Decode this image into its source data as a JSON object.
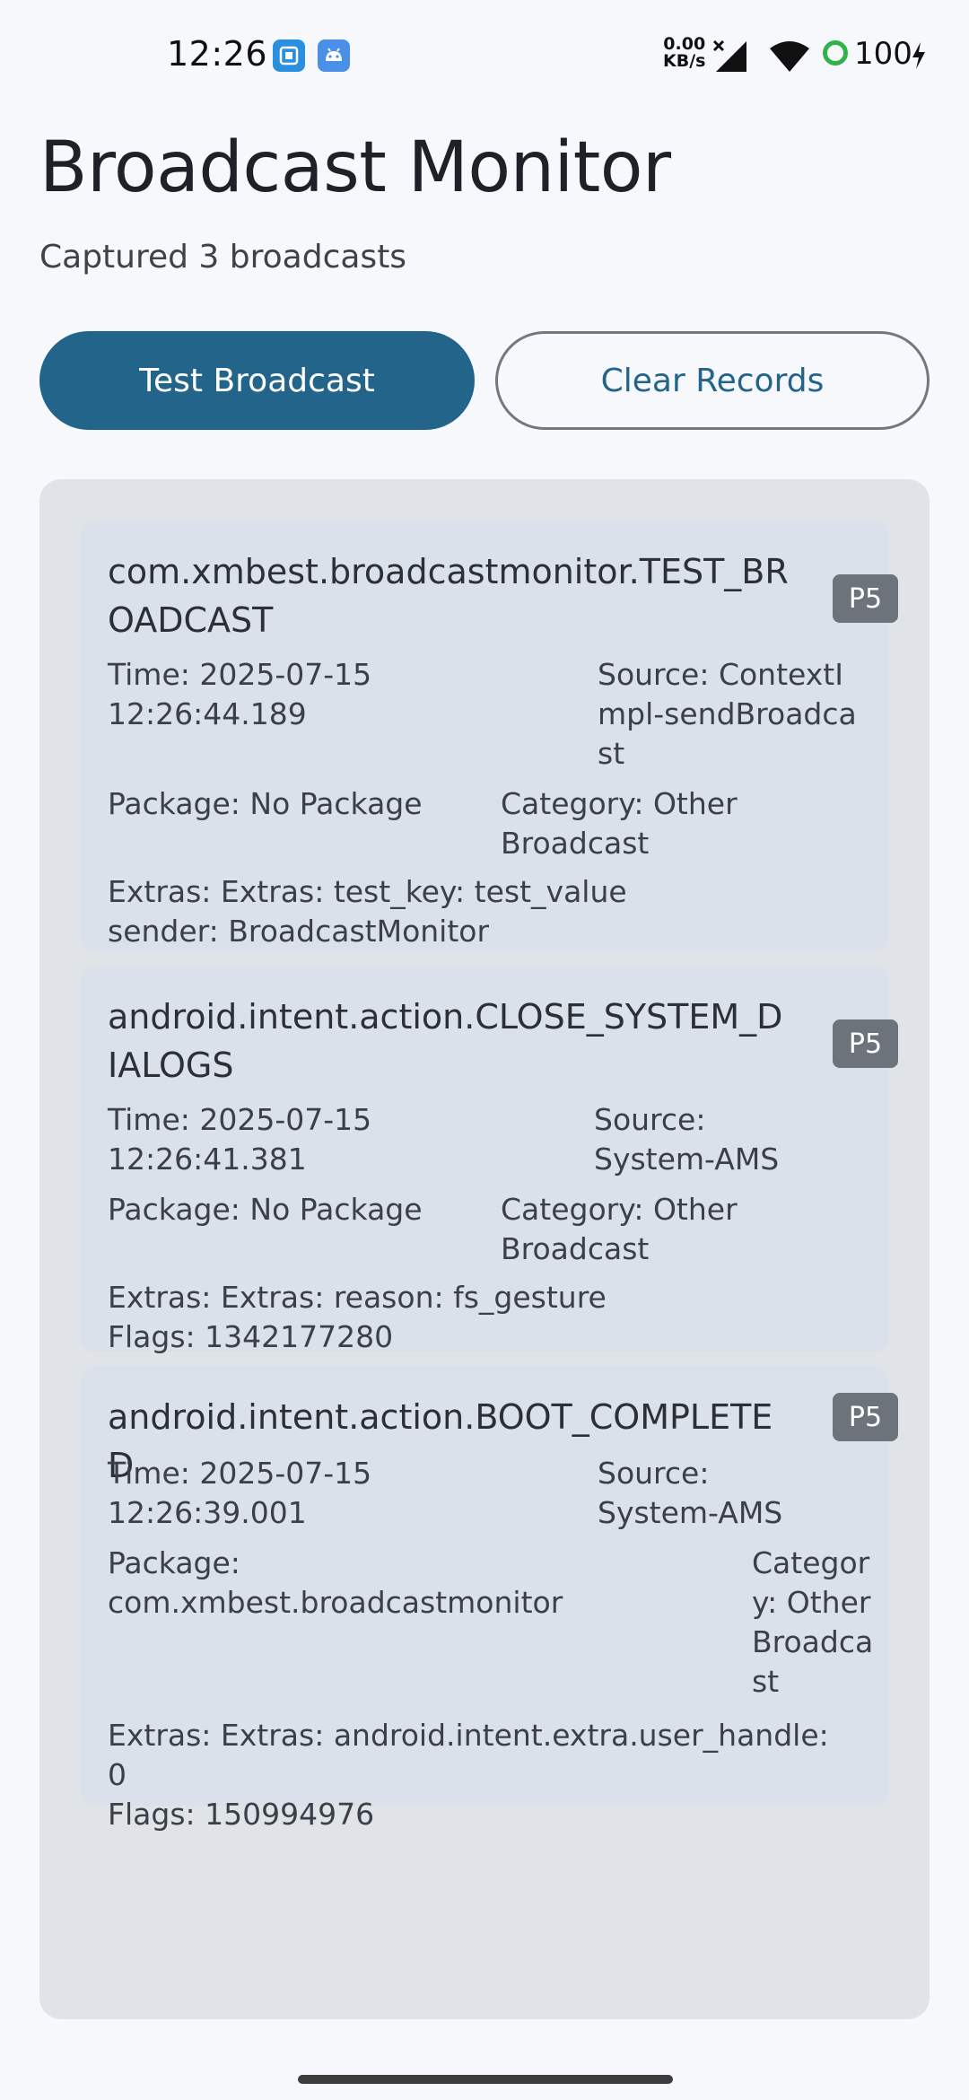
{
  "status_bar": {
    "time": "12:26",
    "net_speed_value": "0.00",
    "net_speed_unit": "KB/s",
    "battery": "100",
    "icons": [
      "app-notification-icon",
      "android-notification-icon",
      "signal-icon",
      "wifi-icon",
      "battery-icon",
      "charging-bolt-icon"
    ],
    "battery_color": "#2fb34a"
  },
  "header": {
    "title": "Broadcast Monitor",
    "subtitle": "Captured 3 broadcasts"
  },
  "buttons": {
    "test_label": "Test Broadcast",
    "clear_label": "Clear Records"
  },
  "colors": {
    "primary": "#23648a",
    "badge": "#6d737a",
    "card": "#dbe1ea",
    "panel": "#e0e3e8"
  },
  "broadcasts": [
    {
      "action": "com.xmbest.broadcastmonitor.TEST_BROADCAST",
      "priority": "P5",
      "time": "Time: 2025-07-15 12:26:44.189",
      "source": "Source: ContextImpl-sendBroadcast",
      "package": "Package: No Package",
      "category": "Category: Other Broadcast",
      "extras": "Extras: Extras: test_key: test_value\nsender: BroadcastMonitor"
    },
    {
      "action": "android.intent.action.CLOSE_SYSTEM_DIALOGS",
      "priority": "P5",
      "time": "Time: 2025-07-15 12:26:41.381",
      "source": "Source: System-AMS",
      "package": "Package: No Package",
      "category": "Category: Other Broadcast",
      "extras": "Extras: Extras: reason: fs_gesture\nFlags: 1342177280"
    },
    {
      "action": "android.intent.action.BOOT_COMPLETED",
      "priority": "P5",
      "time": "Time: 2025-07-15 12:26:39.001",
      "source": "Source: System-AMS",
      "package": "Package: com.xmbest.broadcastmonitor",
      "category": "Category: Other Broadcast",
      "extras": "Extras: Extras: android.intent.extra.user_handle: 0\nFlags: 150994976"
    }
  ]
}
